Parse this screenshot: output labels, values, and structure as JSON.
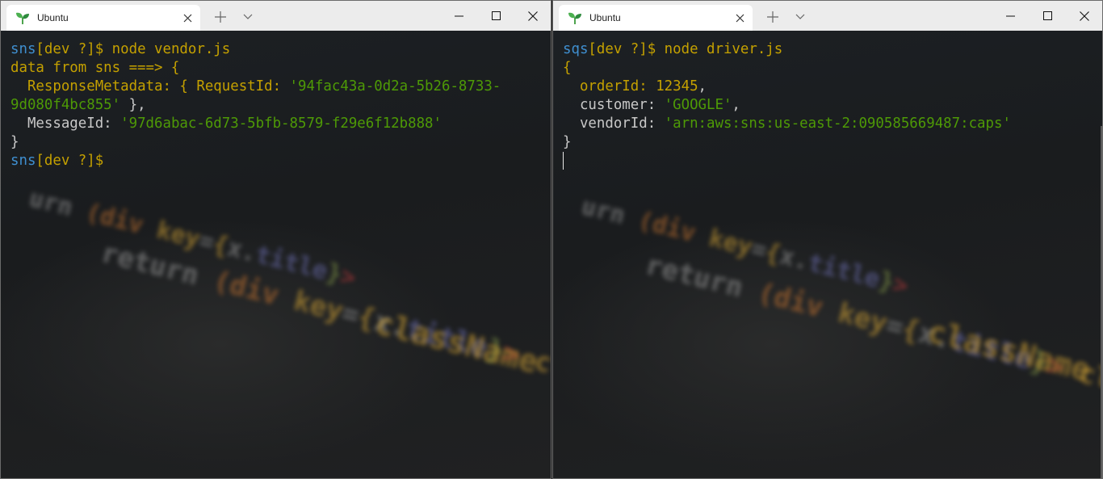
{
  "windows": [
    {
      "tab_title": "Ubuntu",
      "prompt": {
        "host": "sns",
        "branch": "[dev ?]$",
        "command": " node vendor.js"
      },
      "output": {
        "line1": "data from sns ===> {",
        "rm_key": "ResponseMetadata: { RequestId: ",
        "rm_val1": "'94fac43a-0d2a-5b26-8733-",
        "rm_val2": "9d080f4bc855'",
        "rm_close": " },",
        "mid_key": "MessageId: ",
        "mid_val": "'97d6abac-6d73-5bfb-8579-f29e6f12b888'",
        "close": "}"
      },
      "prompt2": {
        "host": "sns",
        "branch": "[dev ?]$"
      }
    },
    {
      "tab_title": "Ubuntu",
      "prompt": {
        "host": "sqs",
        "branch": "[dev ?]$",
        "command": " node driver.js"
      },
      "output": {
        "open": "{",
        "order_key": "orderId: ",
        "order_val": "12345",
        "customer_key": "customer: ",
        "customer_val": "'GOOGLE'",
        "vendor_key": "vendorId: ",
        "vendor_val": "'arn:aws:sns:us-east-2:090585669487:caps'",
        "close": "}",
        "comma": ","
      }
    }
  ],
  "icons": {
    "tab_icon": "sprout-icon",
    "close": "close-icon",
    "new_tab": "plus-icon",
    "dropdown": "chevron-down-icon",
    "minimize": "minimize-icon",
    "maximize": "maximize-icon",
    "window_close": "close-icon"
  },
  "colors": {
    "prompt_host": "#3f8fd0",
    "text_yellow": "#c4a000",
    "string_green": "#4e9a06",
    "titlebar": "#ececec"
  }
}
